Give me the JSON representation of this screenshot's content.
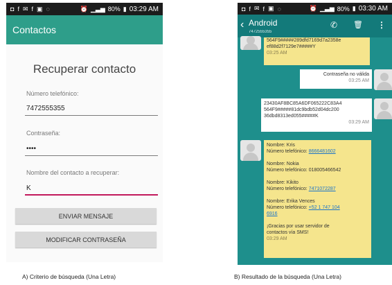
{
  "status_bar_a": {
    "time": "03:29 AM",
    "battery": "80%"
  },
  "status_bar_b": {
    "time": "03:30 AM",
    "battery": "80%"
  },
  "screen_a": {
    "app_title": "Contactos",
    "heading": "Recuperar contacto",
    "phone_label": "Número telefónico:",
    "phone_value": "7472555355",
    "password_label": "Contraseña:",
    "password_value": "••••",
    "contact_label": "Nombre del contacto a recuperar:",
    "contact_value": "K",
    "send_button": "ENVIAR MENSAJE",
    "change_password_button": "MODIFICAR CONTRASEÑA"
  },
  "screen_b": {
    "contact_name": "Android",
    "contact_number": "7472555355",
    "msg1": {
      "lines": [
        "564F9#####289dfd7169d7a2358e",
        "ef88d2f7129e7#####Y"
      ],
      "time": "03:25 AM"
    },
    "msg2": {
      "text": "Contraseña no válida",
      "time": "03:25 AM"
    },
    "msg3": {
      "lines": [
        "23430AF8BC85A6DF065222C83A4",
        "564F9#####81dc9bdb52d04dc200",
        "36dbd8313ed055#####K"
      ],
      "time": "03:29 AM"
    },
    "msg4": {
      "contacts": [
        {
          "name": "Nombre: Kris",
          "phone_label": "Número telefónico:",
          "phone": "8666481602",
          "link": true
        },
        {
          "name": "Nombre: Nokia",
          "phone_label": "Número telefónico:",
          "phone": "018005466542",
          "link": false
        },
        {
          "name": "Nombre: Kikito",
          "phone_label": "Número telefónico:",
          "phone": "7471072287",
          "link": true
        },
        {
          "name": "Nombre: Erika Vences",
          "phone_label": "Número telefónico:",
          "phone": "+52 1 747 104",
          "phone_cont": "6916",
          "link": true
        }
      ],
      "closing_1": "¡Gracias por usar servidor de",
      "closing_2": "contactos vía SMS!",
      "time": "03:29 AM"
    }
  },
  "captions": {
    "a": "A)     Criterio de búsqueda (Una Letra)",
    "b": "B)     Resultado de la  búsqueda (Una Letra)"
  },
  "colors": {
    "appbar_a": "#2e9e8a",
    "appbar_b": "#137a7a",
    "bg_b": "#1e8f8c",
    "bubble_in": "#f5e58d",
    "accent": "#c2185b",
    "link": "#1a73c9"
  }
}
